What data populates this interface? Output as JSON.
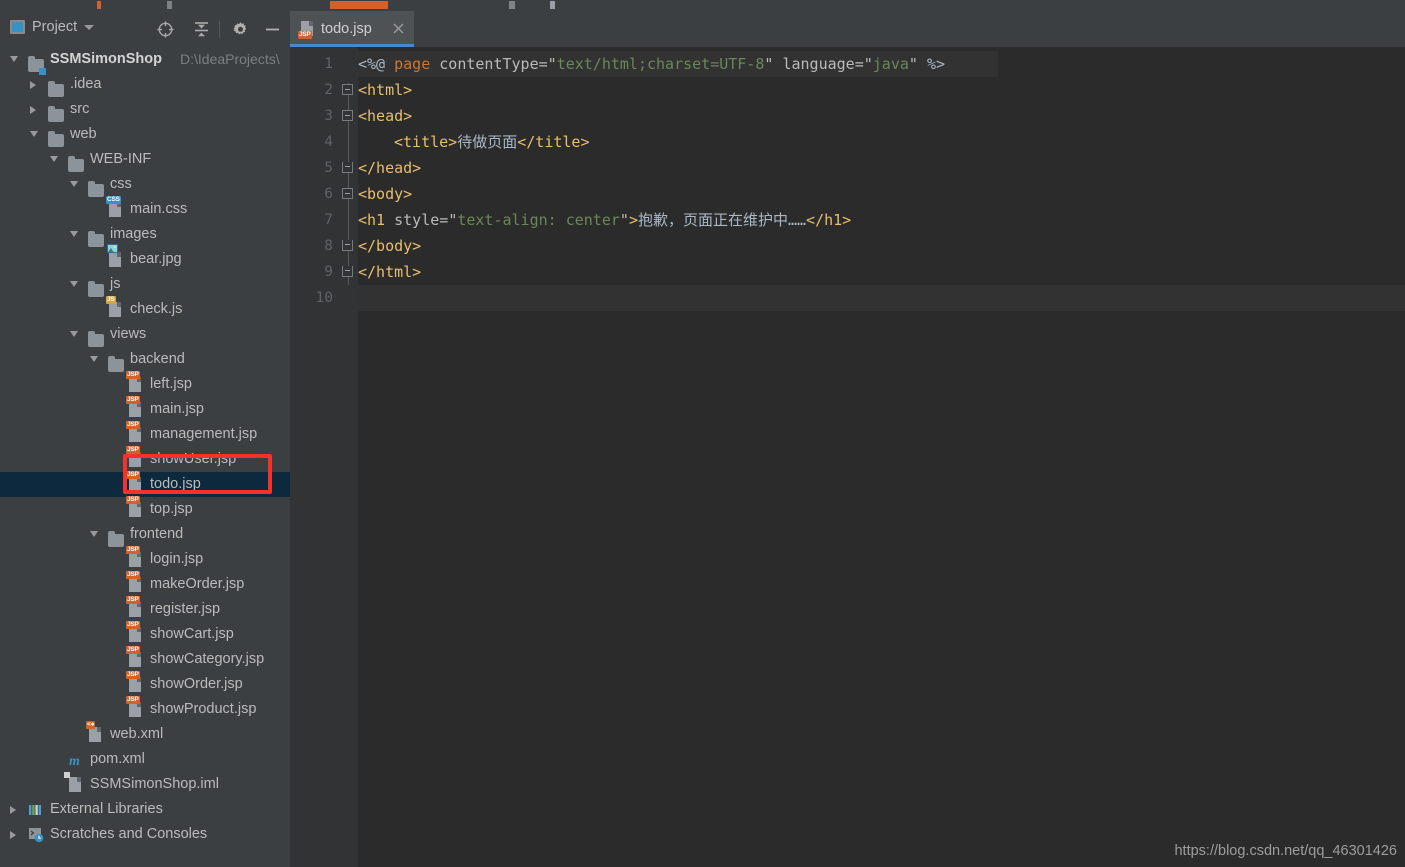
{
  "window": {
    "theme_bg": "#3c3f41",
    "editor_bg": "#2b2b2b",
    "accent": "#4a88c7",
    "annotation_color": "#f5312b",
    "selection_color": "#0d293e"
  },
  "sidebar": {
    "panel_title": "Project",
    "panel_icon": "project-window-icon",
    "dropdown_icon": "chevron-down-icon",
    "toolbar": [
      {
        "name": "locate-icon",
        "title": "Select Opened File"
      },
      {
        "name": "collapse-all-icon",
        "title": "Collapse All"
      },
      {
        "name": "gear-icon",
        "title": "Settings"
      },
      {
        "name": "minimize-icon",
        "title": "Hide"
      }
    ],
    "tree": [
      {
        "label": "SSMSimonShop",
        "suffix": "D:\\IdeaProjects\\",
        "depth": 0,
        "arrow": "open",
        "icon": "module-folder-icon",
        "bold": true,
        "selected": false
      },
      {
        "label": ".idea",
        "depth": 1,
        "arrow": "closed",
        "icon": "folder-icon",
        "selected": false
      },
      {
        "label": "src",
        "depth": 1,
        "arrow": "closed",
        "icon": "folder-icon",
        "selected": false
      },
      {
        "label": "web",
        "depth": 1,
        "arrow": "open",
        "icon": "folder-icon",
        "selected": false
      },
      {
        "label": "WEB-INF",
        "depth": 2,
        "arrow": "open",
        "icon": "folder-icon",
        "selected": false
      },
      {
        "label": "css",
        "depth": 3,
        "arrow": "open",
        "icon": "folder-icon",
        "selected": false
      },
      {
        "label": "main.css",
        "depth": 4,
        "arrow": "none",
        "icon": "css-file-icon",
        "tag": "CSS",
        "tag_bg": "#3592c4",
        "selected": false
      },
      {
        "label": "images",
        "depth": 3,
        "arrow": "open",
        "icon": "folder-icon",
        "selected": false
      },
      {
        "label": "bear.jpg",
        "depth": 4,
        "arrow": "none",
        "icon": "image-file-icon",
        "selected": false
      },
      {
        "label": "js",
        "depth": 3,
        "arrow": "open",
        "icon": "folder-icon",
        "selected": false
      },
      {
        "label": "check.js",
        "depth": 4,
        "arrow": "none",
        "icon": "js-file-icon",
        "tag": "JS",
        "tag_bg": "#d6a23c",
        "selected": false
      },
      {
        "label": "views",
        "depth": 3,
        "arrow": "open",
        "icon": "folder-icon",
        "selected": false
      },
      {
        "label": "backend",
        "depth": 4,
        "arrow": "open",
        "icon": "folder-icon",
        "selected": false
      },
      {
        "label": "left.jsp",
        "depth": 5,
        "arrow": "none",
        "icon": "jsp-file-icon",
        "tag": "JSP",
        "tag_bg": "#d2612b",
        "selected": false
      },
      {
        "label": "main.jsp",
        "depth": 5,
        "arrow": "none",
        "icon": "jsp-file-icon",
        "tag": "JSP",
        "tag_bg": "#d2612b",
        "selected": false
      },
      {
        "label": "management.jsp",
        "depth": 5,
        "arrow": "none",
        "icon": "jsp-file-icon",
        "tag": "JSP",
        "tag_bg": "#d2612b",
        "selected": false
      },
      {
        "label": "showUser.jsp",
        "depth": 5,
        "arrow": "none",
        "icon": "jsp-file-icon",
        "tag": "JSP",
        "tag_bg": "#d2612b",
        "selected": false
      },
      {
        "label": "todo.jsp",
        "depth": 5,
        "arrow": "none",
        "icon": "jsp-file-icon",
        "tag": "JSP",
        "tag_bg": "#d2612b",
        "selected": true
      },
      {
        "label": "top.jsp",
        "depth": 5,
        "arrow": "none",
        "icon": "jsp-file-icon",
        "tag": "JSP",
        "tag_bg": "#d2612b",
        "selected": false
      },
      {
        "label": "frontend",
        "depth": 4,
        "arrow": "open",
        "icon": "folder-icon",
        "selected": false
      },
      {
        "label": "login.jsp",
        "depth": 5,
        "arrow": "none",
        "icon": "jsp-file-icon",
        "tag": "JSP",
        "tag_bg": "#d2612b",
        "selected": false
      },
      {
        "label": "makeOrder.jsp",
        "depth": 5,
        "arrow": "none",
        "icon": "jsp-file-icon",
        "tag": "JSP",
        "tag_bg": "#d2612b",
        "selected": false
      },
      {
        "label": "register.jsp",
        "depth": 5,
        "arrow": "none",
        "icon": "jsp-file-icon",
        "tag": "JSP",
        "tag_bg": "#d2612b",
        "selected": false
      },
      {
        "label": "showCart.jsp",
        "depth": 5,
        "arrow": "none",
        "icon": "jsp-file-icon",
        "tag": "JSP",
        "tag_bg": "#d2612b",
        "selected": false
      },
      {
        "label": "showCategory.jsp",
        "depth": 5,
        "arrow": "none",
        "icon": "jsp-file-icon",
        "tag": "JSP",
        "tag_bg": "#d2612b",
        "selected": false
      },
      {
        "label": "showOrder.jsp",
        "depth": 5,
        "arrow": "none",
        "icon": "jsp-file-icon",
        "tag": "JSP",
        "tag_bg": "#d2612b",
        "selected": false
      },
      {
        "label": "showProduct.jsp",
        "depth": 5,
        "arrow": "none",
        "icon": "jsp-file-icon",
        "tag": "JSP",
        "tag_bg": "#d2612b",
        "selected": false
      },
      {
        "label": "web.xml",
        "depth": 3,
        "arrow": "none",
        "icon": "xml-file-icon",
        "tag": "<●",
        "tag_bg": "#d2612b",
        "selected": false
      },
      {
        "label": "pom.xml",
        "depth": 2,
        "arrow": "none",
        "icon": "maven-file-icon",
        "selected": false
      },
      {
        "label": "SSMSimonShop.iml",
        "depth": 2,
        "arrow": "none",
        "icon": "iml-file-icon",
        "selected": false
      },
      {
        "label": "External Libraries",
        "depth": 0,
        "arrow": "closed",
        "icon": "libraries-icon",
        "selected": false
      },
      {
        "label": "Scratches and Consoles",
        "depth": 0,
        "arrow": "closed",
        "icon": "scratches-icon",
        "selected": false
      }
    ]
  },
  "editor": {
    "tab": {
      "label": "todo.jsp",
      "icon": "jsp-file-icon",
      "tag": "JSP",
      "close_icon": "close-icon",
      "active": true
    },
    "gutter_numbers": [
      "1",
      "2",
      "3",
      "4",
      "5",
      "6",
      "7",
      "8",
      "9",
      "10"
    ],
    "caret_line": 10,
    "highlighted_line": 1,
    "lines": [
      {
        "n": 1,
        "indent": 0,
        "fold": "none",
        "tokens": [
          {
            "t": "<%@ ",
            "c": "punc"
          },
          {
            "t": "page",
            "c": "kw"
          },
          {
            "t": " contentType=",
            "c": "attr"
          },
          {
            "t": "\"",
            "c": "attr"
          },
          {
            "t": "text/html;charset=UTF-8",
            "c": "str"
          },
          {
            "t": "\"",
            "c": "attr"
          },
          {
            "t": " language=",
            "c": "attr"
          },
          {
            "t": "\"",
            "c": "attr"
          },
          {
            "t": "java",
            "c": "str"
          },
          {
            "t": "\"",
            "c": "attr"
          },
          {
            "t": " %>",
            "c": "punc"
          }
        ]
      },
      {
        "n": 2,
        "indent": 0,
        "fold": "start",
        "tokens": [
          {
            "t": "<html>",
            "c": "tag"
          }
        ]
      },
      {
        "n": 3,
        "indent": 0,
        "fold": "start",
        "tokens": [
          {
            "t": "<head>",
            "c": "tag"
          }
        ]
      },
      {
        "n": 4,
        "indent": 4,
        "fold": "none",
        "tokens": [
          {
            "t": "<title>",
            "c": "tag"
          },
          {
            "t": "待做页面",
            "c": "txt"
          },
          {
            "t": "</title>",
            "c": "tag"
          }
        ]
      },
      {
        "n": 5,
        "indent": 0,
        "fold": "end",
        "tokens": [
          {
            "t": "</head>",
            "c": "tag"
          }
        ]
      },
      {
        "n": 6,
        "indent": 0,
        "fold": "start",
        "tokens": [
          {
            "t": "<body>",
            "c": "tag"
          }
        ]
      },
      {
        "n": 7,
        "indent": 0,
        "fold": "none",
        "tokens": [
          {
            "t": "<h1",
            "c": "tag"
          },
          {
            "t": " style=",
            "c": "attr"
          },
          {
            "t": "\"",
            "c": "attr"
          },
          {
            "t": "text-align: center",
            "c": "str"
          },
          {
            "t": "\"",
            "c": "attr"
          },
          {
            "t": ">",
            "c": "tag"
          },
          {
            "t": "抱歉，页面正在维护中……",
            "c": "txt"
          },
          {
            "t": "</h1>",
            "c": "tag"
          }
        ]
      },
      {
        "n": 8,
        "indent": 0,
        "fold": "end",
        "tokens": [
          {
            "t": "</body>",
            "c": "tag"
          }
        ]
      },
      {
        "n": 9,
        "indent": 0,
        "fold": "end",
        "tokens": [
          {
            "t": "</html>",
            "c": "tag"
          }
        ]
      },
      {
        "n": 10,
        "indent": 0,
        "fold": "none",
        "tokens": []
      }
    ]
  },
  "annotation": {
    "shape": "rectangle",
    "target": "todo.jsp",
    "color": "#f5312b"
  },
  "watermark": {
    "text": "https://blog.csdn.net/qq_46301426"
  }
}
